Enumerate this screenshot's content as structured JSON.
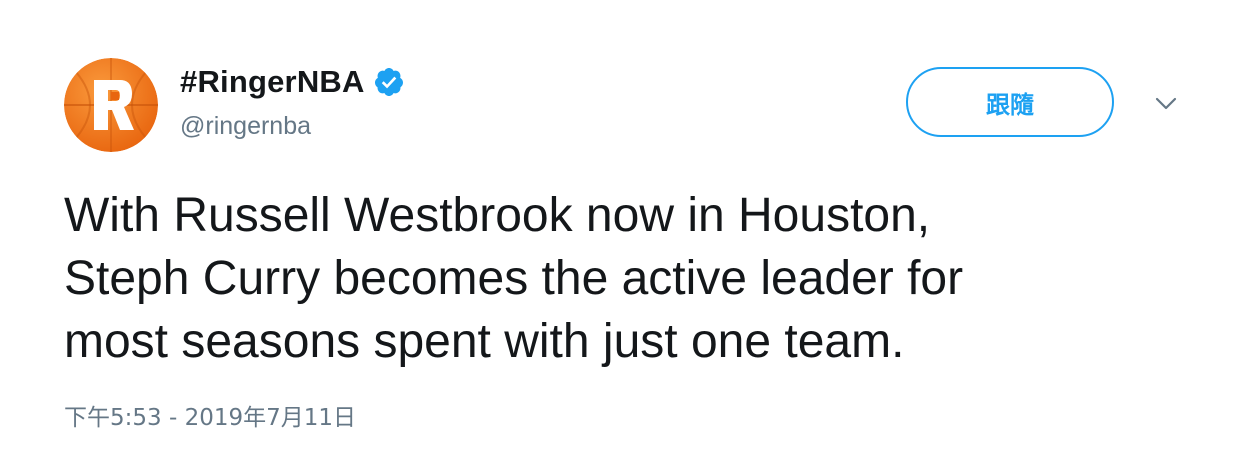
{
  "tweet": {
    "display_name": "#RingerNBA",
    "handle": "@ringernba",
    "follow_label": "跟隨",
    "text": "With Russell Westbrook now in Houston,\nSteph Curry becomes the active leader for\nmost seasons spent with just one team.",
    "timestamp": "下午5:53 - 2019年7月11日",
    "avatar_icon": "ringer-logo-icon",
    "verified_icon": "verified-badge-icon",
    "menu_icon": "chevron-down-icon"
  },
  "colors": {
    "accent": "#1da1f2",
    "text_primary": "#14171a",
    "text_secondary": "#657786",
    "avatar_orange": "#f4781f"
  }
}
